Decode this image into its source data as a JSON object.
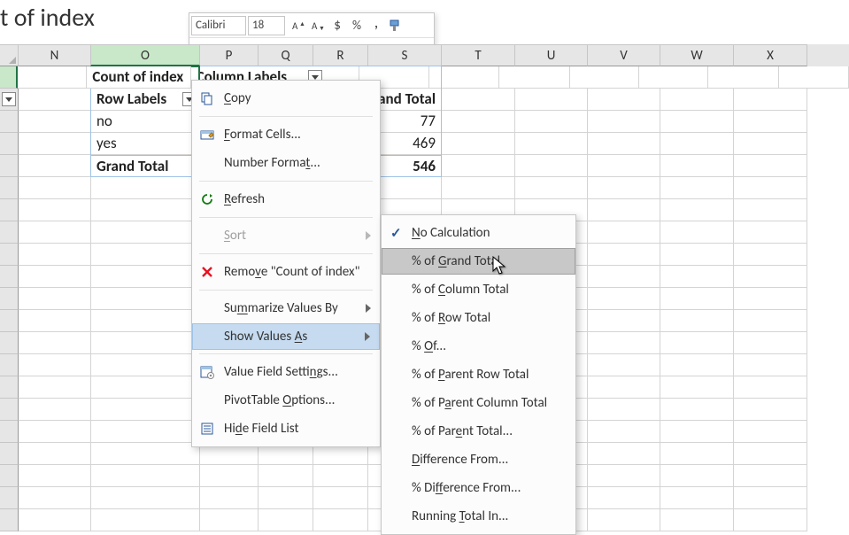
{
  "title_partial": "t of index",
  "toolbar": {
    "font_name": "Calibri",
    "font_size": "18"
  },
  "columns": {
    "N_width": 82,
    "widths": {
      "stub": 21,
      "N": 82,
      "O": 123,
      "P": 66,
      "Q": 62,
      "R": 62,
      "S": 83,
      "T": 83,
      "U": 82,
      "V": 82,
      "W": 83,
      "X": 83
    },
    "labels": [
      "N",
      "O",
      "P",
      "Q",
      "R",
      "S",
      "T",
      "U",
      "V",
      "W",
      "X"
    ]
  },
  "pivot": {
    "count_label": "Count of index",
    "column_labels_label": "Column Labels",
    "row_labels_label": "Row Labels",
    "grand_total_label": "Grand Total",
    "rows": [
      {
        "label": "no",
        "grand": "77"
      },
      {
        "label": "yes",
        "grand": "469"
      }
    ],
    "grand_row_label": "Grand Total",
    "grand_row_value": "546"
  },
  "context_menu": {
    "copy": "Copy",
    "format_cells": "Format Cells...",
    "number_format": "Number Format...",
    "refresh": "Refresh",
    "sort": "Sort",
    "remove": "Remove \"Count of index\"",
    "summarize": "Summarize Values By",
    "show_values": "Show Values As",
    "value_field": "Value Field Settings...",
    "pivot_options": "PivotTable Options...",
    "hide_field": "Hide Field List"
  },
  "submenu": {
    "no_calc": "No Calculation",
    "pct_grand": "% of Grand Total",
    "pct_col": "% of Column Total",
    "pct_row": "% of Row Total",
    "pct_of": "% Of...",
    "pct_parent_row": "% of Parent Row Total",
    "pct_parent_col": "% of Parent Column Total",
    "pct_parent": "% of Parent Total...",
    "diff": "Difference From...",
    "pct_diff": "% Difference From...",
    "running": "Running Total In..."
  }
}
